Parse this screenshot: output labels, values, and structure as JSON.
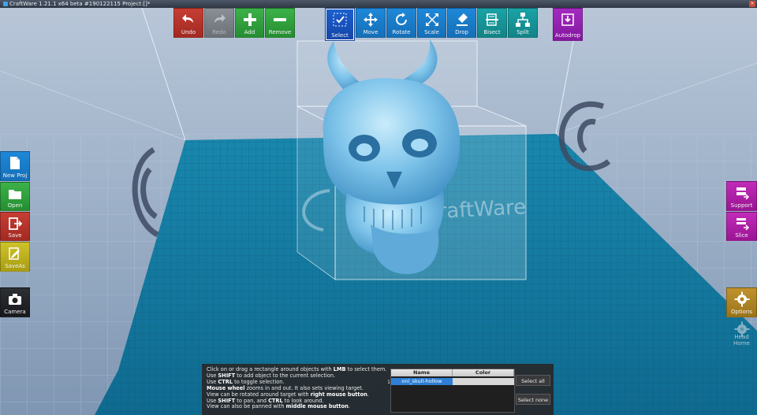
{
  "window": {
    "title": "CraftWare 1.21.1 x64 beta #190122115   Project:[]*",
    "close_glyph": "×"
  },
  "toolbar_edit": {
    "undo": "Undo",
    "redo": "Redo",
    "add": "Add",
    "remove": "Remove"
  },
  "toolbar_tools": {
    "select": "Select",
    "move": "Move",
    "rotate": "Rotate",
    "scale": "Scale",
    "drop": "Drop",
    "bisect": "Bisect",
    "split": "Split",
    "autodrop": "Autodrop"
  },
  "left_panel": {
    "new_project": "New Proj",
    "open": "Open",
    "save": "Save",
    "save_as": "SaveAs",
    "camera": "Camera"
  },
  "right_panel": {
    "support": "Support",
    "slice": "Slice",
    "options": "Options",
    "head_home": "Head Home"
  },
  "help": {
    "l1a": "Click on or drag a rectangle around objects with ",
    "l1b": "LMB",
    "l1c": " to select them.",
    "l2a": "Use ",
    "l2b": "SHIFT",
    "l2c": " to add object to the current selection.",
    "l3a": "Use ",
    "l3b": "CTRL",
    "l3c": " to toggle selection.",
    "l4a": "Mouse wheel",
    "l4b": " zooms in and out. It also sets viewing target.",
    "l5a": "View can be rotated around target with ",
    "l5b": "right mouse button",
    "l5c": ".",
    "l6a": "Use ",
    "l6b": "SHIFT",
    "l6c": " to pan, and ",
    "l6d": "CTRL",
    "l6e": " to look around.",
    "l7a": "View can also be panned with ",
    "l7b": "middle mouse button",
    "l7c": "."
  },
  "object_list": {
    "col_name": "Name",
    "col_color": "Color",
    "rows": [
      {
        "index": "1",
        "name": "oni_skull-hollow"
      }
    ],
    "select_all": "Select all",
    "select_none": "Select none"
  },
  "viewport": {
    "watermark": "CraftWare"
  },
  "colors": {
    "bed": "#1b7fa6",
    "bed_dark": "#0e5e80",
    "model": "#7fc4ea",
    "background": "#9fb3cc"
  }
}
